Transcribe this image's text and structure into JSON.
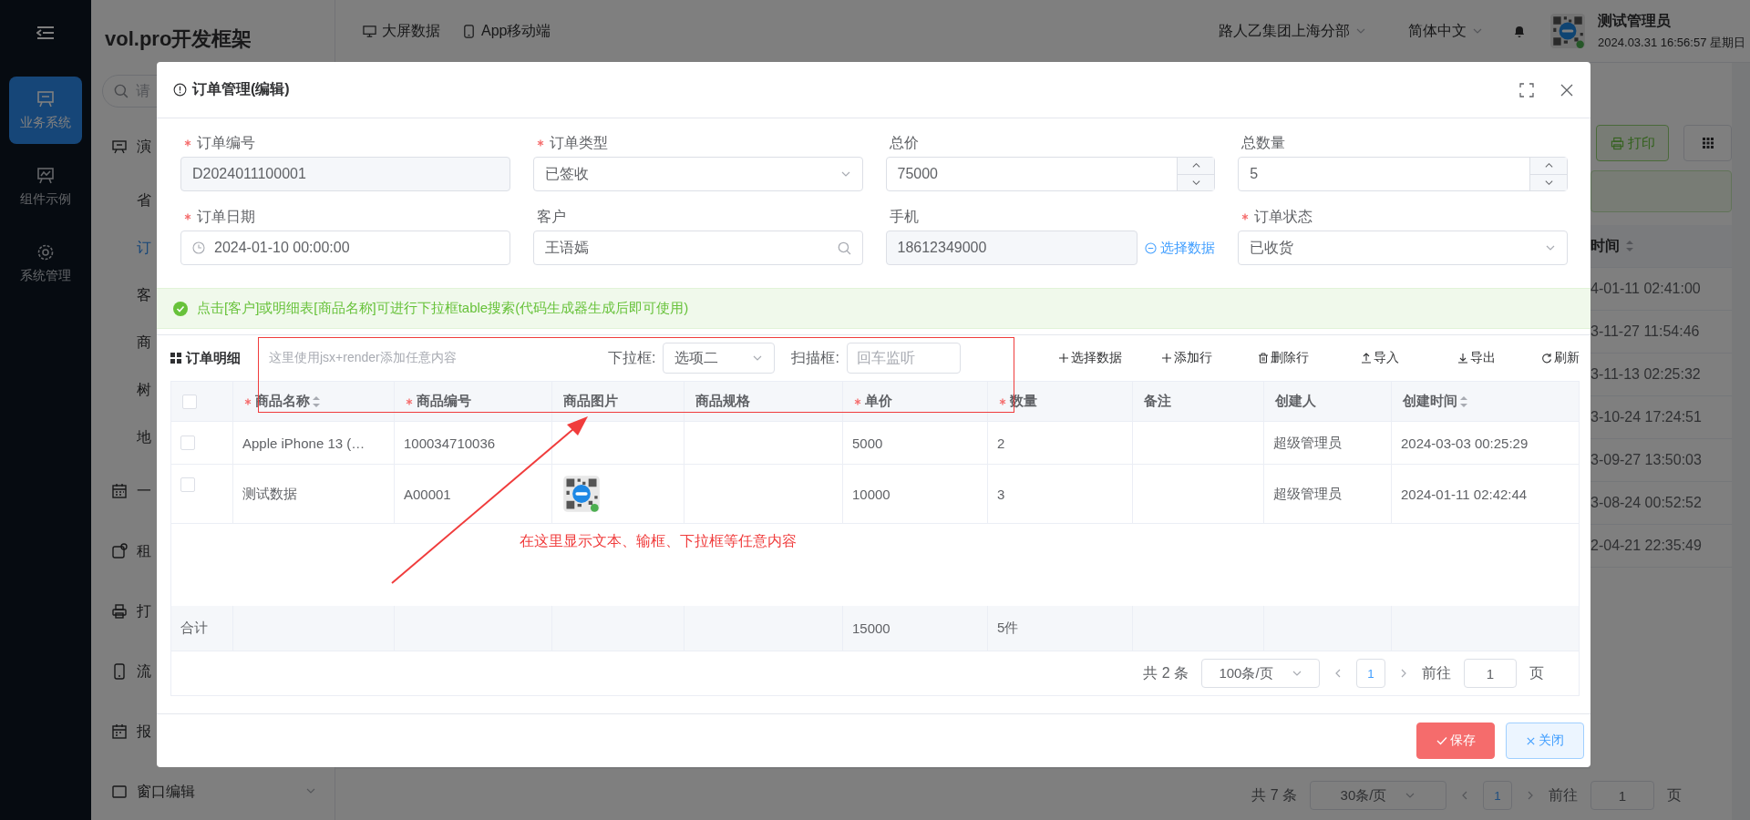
{
  "sidebar": {
    "items": [
      {
        "label": "业务系统",
        "selected": true
      },
      {
        "label": "组件示例",
        "selected": false
      },
      {
        "label": "系统管理",
        "selected": false
      }
    ]
  },
  "menu": {
    "title": "vol.pro开发框架",
    "search_placeholder": "请",
    "items": [
      {
        "label": "演",
        "children": [
          {
            "label": "省",
            "selected": false
          },
          {
            "label": "订",
            "selected": true
          },
          {
            "label": "客",
            "selected": false
          },
          {
            "label": "商",
            "selected": false
          },
          {
            "label": "树",
            "selected": false
          },
          {
            "label": "地",
            "selected": false
          }
        ]
      },
      {
        "label": "一"
      },
      {
        "label": "租"
      },
      {
        "label": "打"
      },
      {
        "label": "流"
      },
      {
        "label": "报"
      },
      {
        "label": "窗口编辑"
      }
    ]
  },
  "header": {
    "links": [
      "大屏数据",
      "App移动端"
    ],
    "org": "路人乙集团上海分部",
    "language": "简体中文",
    "user": {
      "name": "测试管理员",
      "datetime": "2024.03.31 16:56:57 星期日"
    }
  },
  "background_page": {
    "print_button": "打印",
    "column_header": "时间",
    "rows": [
      "4-01-11 02:41:00",
      "3-11-27 11:54:46",
      "3-11-13 02:25:32",
      "3-10-24 17:24:51",
      "3-09-27 13:50:03",
      "3-08-24 00:52:52",
      "2-04-21 22:35:49"
    ],
    "pagination": {
      "total": "共 7 条",
      "page_size": "30条/页",
      "page": "1",
      "goto_label": "前往",
      "goto_value": "1",
      "page_suffix": "页"
    }
  },
  "dialog": {
    "title": "订单管理(编辑)",
    "form": {
      "fields": [
        {
          "label": "订单编号",
          "required": true,
          "kind": "readonly",
          "value": "D2024011100001"
        },
        {
          "label": "订单类型",
          "required": true,
          "kind": "select",
          "value": "已签收"
        },
        {
          "label": "总价",
          "kind": "number",
          "value": "75000"
        },
        {
          "label": "总数量",
          "kind": "number",
          "value": "5"
        },
        {
          "label": "订单日期",
          "required": true,
          "kind": "date",
          "value": "2024-01-10 00:00:00"
        },
        {
          "label": "客户",
          "kind": "search",
          "value": "王语嫣"
        },
        {
          "label": "手机",
          "kind": "readonly",
          "value": "18612349000",
          "link": "选择数据"
        },
        {
          "label": "订单状态",
          "required": true,
          "kind": "select",
          "value": "已收货"
        }
      ]
    },
    "alert": "点击[客户]或明细表[商品名称]可进行下拉框table搜索(代码生成器生成后即可使用)",
    "detail": {
      "title": "订单明细",
      "custom": {
        "hint": "这里使用jsx+render添加任意内容",
        "select_label": "下拉框:",
        "select_value": "选项二",
        "scan_label": "扫描框:",
        "scan_placeholder": "回车监听"
      },
      "toolbar": [
        "选择数据",
        "添加行",
        "删除行",
        "导入",
        "导出",
        "刷新"
      ],
      "select_all": {
        "checked": false
      },
      "columns": [
        {
          "label": "商品名称",
          "required": true,
          "sortable": true
        },
        {
          "label": "商品编号",
          "required": true
        },
        {
          "label": "商品图片"
        },
        {
          "label": "商品规格"
        },
        {
          "label": "单价",
          "required": true
        },
        {
          "label": "数量",
          "required": true
        },
        {
          "label": "备注"
        },
        {
          "label": "创建人"
        },
        {
          "label": "创建时间",
          "sortable": true
        }
      ],
      "rows": [
        {
          "checked": false,
          "name": "Apple iPhone 13 (…",
          "code": "100034710036",
          "price": "5000",
          "qty": "2",
          "creator": "超级管理员",
          "created": "2024-03-03 00:25:29"
        },
        {
          "checked": false,
          "name": "测试数据",
          "code": "A00001",
          "has_image": true,
          "price": "10000",
          "qty": "3",
          "creator": "超级管理员",
          "created": "2024-01-11 02:42:44"
        }
      ],
      "summary": {
        "label": "合计",
        "price": "15000",
        "qty": "5件"
      },
      "pagination": {
        "total": "共 2 条",
        "page_size": "100条/页",
        "page": "1",
        "goto_label": "前往",
        "goto_value": "1",
        "page_suffix": "页"
      }
    },
    "annotation": {
      "text": "在这里显示文本、输框、下拉框等任意内容"
    },
    "buttons": [
      {
        "label": "保存",
        "kind": "primary"
      },
      {
        "label": "关闭",
        "kind": "secondary"
      }
    ]
  }
}
